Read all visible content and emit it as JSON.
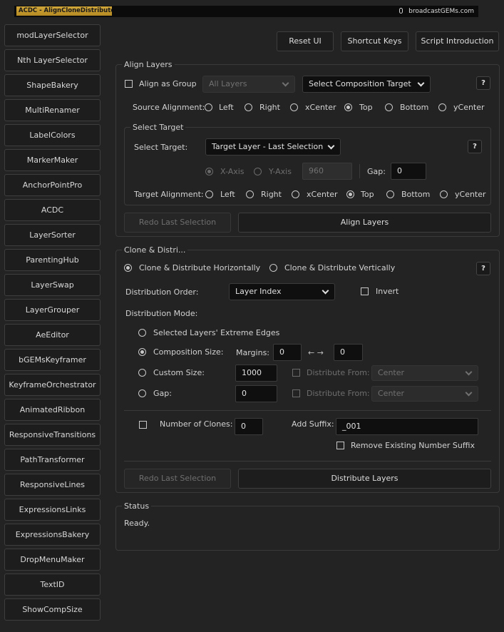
{
  "banner": {
    "logo_text": "ACDC - AlignCloneDistributeClone",
    "brand": "broadcastGEMs.com"
  },
  "sidebar": {
    "items": [
      {
        "label": "modLayerSelector"
      },
      {
        "label": "Nth LayerSelector"
      },
      {
        "label": "ShapeBakery"
      },
      {
        "label": "MultiRenamer"
      },
      {
        "label": "LabelColors"
      },
      {
        "label": "MarkerMaker"
      },
      {
        "label": "AnchorPointPro"
      },
      {
        "label": "ACDC"
      },
      {
        "label": "LayerSorter"
      },
      {
        "label": "ParentingHub"
      },
      {
        "label": "LayerSwap"
      },
      {
        "label": "LayerGrouper"
      },
      {
        "label": "AeEditor"
      },
      {
        "label": "bGEMsKeyframer"
      },
      {
        "label": "KeyframeOrchestrator"
      },
      {
        "label": "AnimatedRibbon"
      },
      {
        "label": "ResponsiveTransitions"
      },
      {
        "label": "PathTransformer"
      },
      {
        "label": "ResponsiveLines"
      },
      {
        "label": "ExpressionsLinks"
      },
      {
        "label": "ExpressionsBakery"
      },
      {
        "label": "DropMenuMaker"
      },
      {
        "label": "TextID"
      },
      {
        "label": "ShowCompSize"
      }
    ]
  },
  "toolbar": {
    "reset": "Reset UI",
    "shortcuts": "Shortcut Keys",
    "intro": "Script Introduction"
  },
  "align": {
    "title": "Align Layers",
    "as_group": "Align as Group",
    "all_layers": "All Layers",
    "comp_target": "Select Composition Target",
    "help": "?",
    "source_label": "Source Alignment:",
    "source_options": [
      "Left",
      "Right",
      "xCenter",
      "Top",
      "Bottom",
      "yCenter"
    ],
    "source_selected": "Top",
    "target_group": {
      "title": "Select Target",
      "label": "Select Target:",
      "value": "Target Layer - Last Selection",
      "help": "?",
      "x_axis": "X-Axis",
      "y_axis": "Y-Axis",
      "axis_value": "960",
      "gap_label": "Gap:",
      "gap_value": "0",
      "target_align_label": "Target Alignment:",
      "target_options": [
        "Left",
        "Right",
        "xCenter",
        "Top",
        "Bottom",
        "yCenter"
      ],
      "target_selected": "Top"
    },
    "redo": "Redo Last Selection",
    "align_btn": "Align Layers"
  },
  "clone": {
    "title": "Clone & Distri...",
    "horiz": "Clone & Distribute Horizontally",
    "vert": "Clone & Distribute Vertically",
    "help": "?",
    "order_label": "Distribution Order:",
    "order_value": "Layer Index",
    "invert": "Invert",
    "mode_label": "Distribution Mode:",
    "mode_edges": "Selected Layers' Extreme Edges",
    "mode_comp": "Composition Size:",
    "margins_label": "Margins:",
    "margin_left": "0",
    "arrows": "← →",
    "margin_right": "0",
    "mode_custom": "Custom Size:",
    "custom_value": "1000",
    "dist_from": "Distribute From:",
    "dist_value": "Center",
    "mode_gap": "Gap:",
    "gap_value": "0",
    "dist_from2": "Distribute From:",
    "dist_value2": "Center",
    "num_clones": "Number of Clones:",
    "num_value": "0",
    "suffix_label": "Add Suffix:",
    "suffix_value": "_001",
    "remove_suffix": "Remove Existing Number Suffix",
    "redo": "Redo Last Selection",
    "distribute_btn": "Distribute Layers"
  },
  "status": {
    "title": "Status",
    "text": "Ready."
  }
}
